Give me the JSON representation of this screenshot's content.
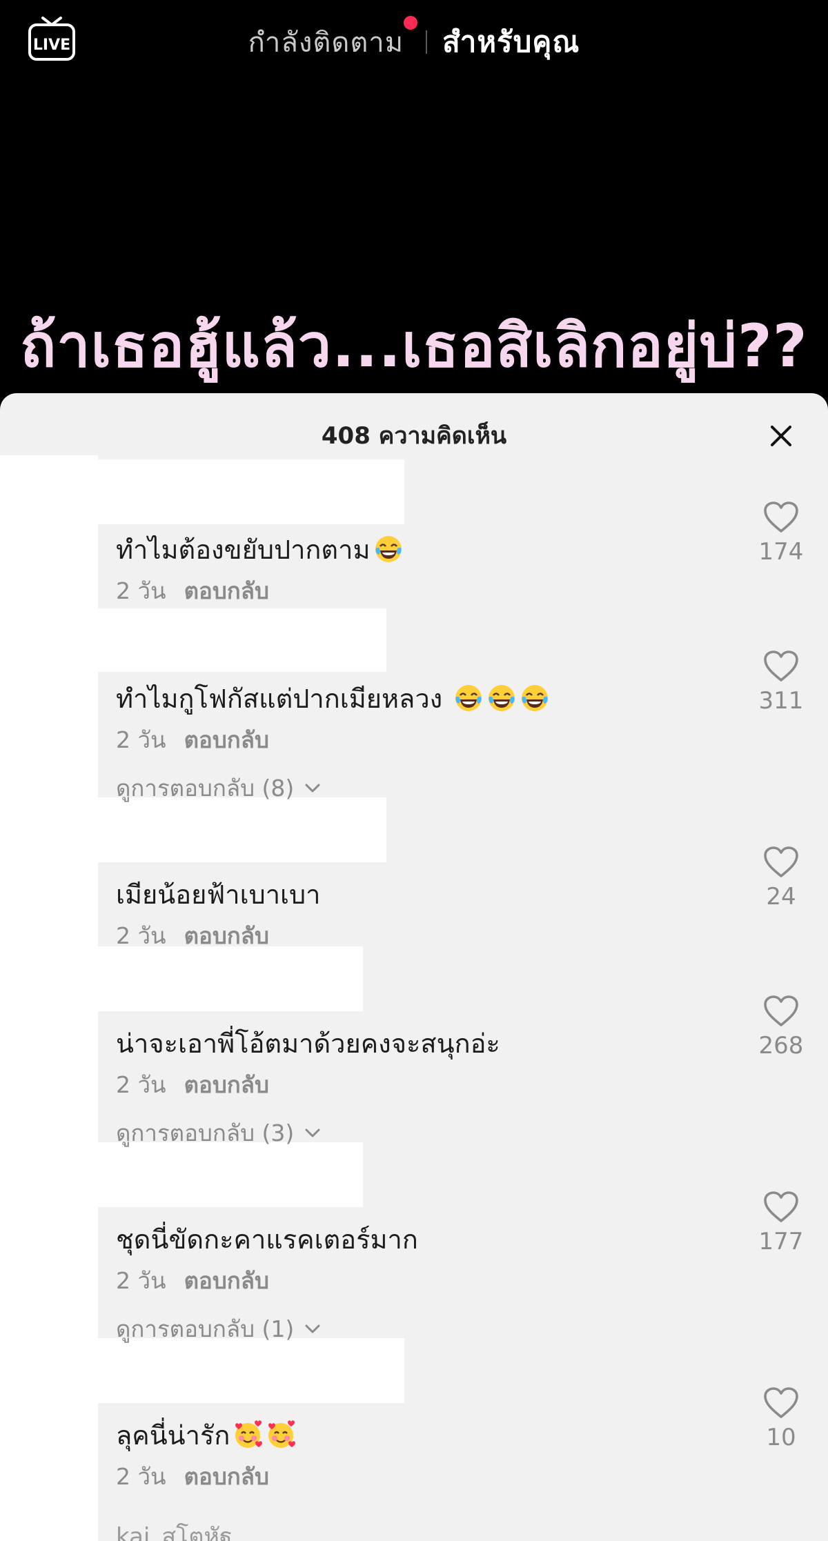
{
  "top_nav": {
    "live_label": "LIVE",
    "following_tab": "กำลังติดตาม",
    "for_you_tab": "สำหรับคุณ",
    "accent_dot_color": "#ff2b54"
  },
  "video": {
    "caption": "ถ้าเธอฮู้แล้ว...เธอสิเลิกอยู่บ่??"
  },
  "comments_sheet": {
    "title": "408 ความคิดเห็น",
    "close_icon": "close-icon",
    "comments": [
      {
        "text": "ทำไมต้องขยับปากตาม",
        "emojis": [
          "laughing-tears-emoji"
        ],
        "time": "2 วัน",
        "reply_label": "ตอบกลับ",
        "likes": "174",
        "view_replies": ""
      },
      {
        "text": "ทำไมกูโฟกัสแต่ปากเมียหลวง ",
        "emojis": [
          "laughing-tears-emoji",
          "laughing-tears-emoji",
          "laughing-tears-emoji"
        ],
        "time": "2 วัน",
        "reply_label": "ตอบกลับ",
        "likes": "311",
        "view_replies": "ดูการตอบกลับ (8)"
      },
      {
        "text": "เมียน้อยฟ้าเบาเบา",
        "emojis": [],
        "time": "2 วัน",
        "reply_label": "ตอบกลับ",
        "likes": "24",
        "view_replies": ""
      },
      {
        "text": "น่าจะเอาพี่โอ้ตมาด้วยคงจะสนุกอ่ะ",
        "emojis": [],
        "time": "2 วัน",
        "reply_label": "ตอบกลับ",
        "likes": "268",
        "view_replies": "ดูการตอบกลับ (3)"
      },
      {
        "text": "ชุดนี่ขัดกะคาแรคเตอร์มาก",
        "emojis": [],
        "time": "2 วัน",
        "reply_label": "ตอบกลับ",
        "likes": "177",
        "view_replies": "ดูการตอบกลับ (1)"
      },
      {
        "text": "ลุคนี่น่ารัก",
        "emojis": [
          "smiling-hearts-emoji",
          "smiling-hearts-emoji"
        ],
        "time": "2 วัน",
        "reply_label": "ตอบกลับ",
        "likes": "10",
        "view_replies": ""
      }
    ],
    "next_username_partial": "kai_สโตหัฐ"
  }
}
